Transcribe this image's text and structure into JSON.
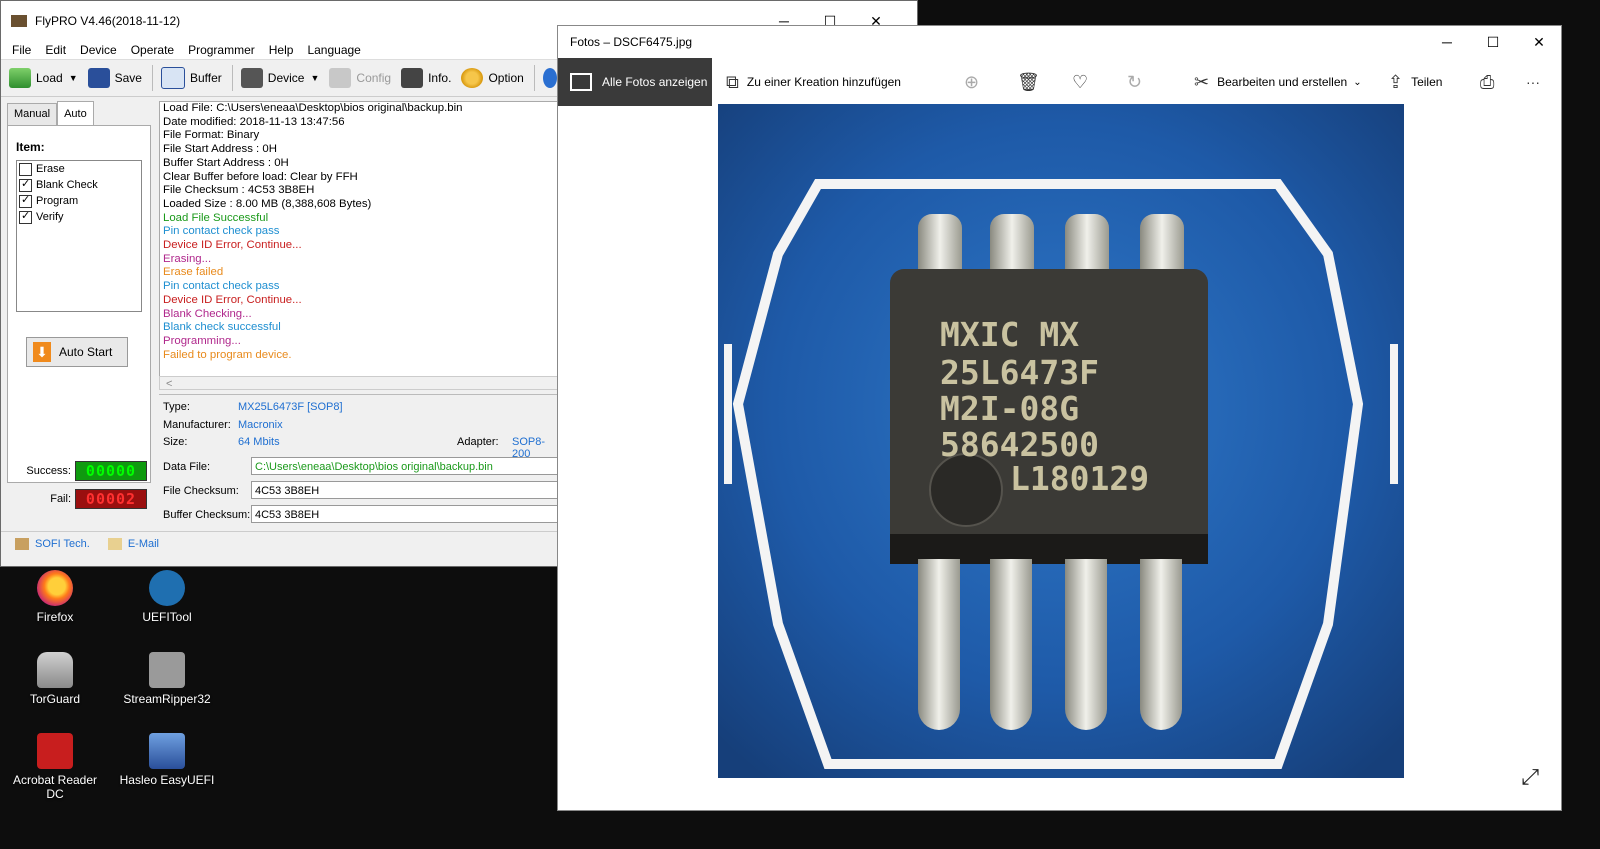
{
  "flypro": {
    "title": "FlyPRO V4.46(2018-11-12)",
    "menu": [
      "File",
      "Edit",
      "Device",
      "Operate",
      "Programmer",
      "Help",
      "Language"
    ],
    "toolbar": {
      "load": "Load",
      "save": "Save",
      "buffer": "Buffer",
      "device": "Device",
      "config": "Config",
      "info": "Info.",
      "option": "Option"
    },
    "tabs": {
      "manual": "Manual",
      "auto": "Auto"
    },
    "item_title": "Item:",
    "items": [
      {
        "label": "Erase",
        "checked": false
      },
      {
        "label": "Blank Check",
        "checked": true
      },
      {
        "label": "Program",
        "checked": true
      },
      {
        "label": "Verify",
        "checked": true
      }
    ],
    "auto_start": "Auto Start",
    "success_label": "Success:",
    "success_value": "00000",
    "fail_label": "Fail:",
    "fail_value": "00002",
    "log": [
      {
        "text": "Load File: C:\\Users\\eneaa\\Desktop\\bios original\\backup.bin",
        "color": "#000000"
      },
      {
        "text": "Date modified: 2018-11-13 13:47:56",
        "color": "#000000"
      },
      {
        "text": "File Format: Binary",
        "color": "#000000"
      },
      {
        "text": "File Start Address      : 0H",
        "color": "#000000"
      },
      {
        "text": "Buffer Start Address  : 0H",
        "color": "#000000"
      },
      {
        "text": "Clear Buffer before load: Clear by FFH",
        "color": "#000000"
      },
      {
        "text": "File Checksum  : 4C53 3B8EH",
        "color": "#000000"
      },
      {
        "text": "Loaded Size  : 8.00 MB (8,388,608 Bytes)",
        "color": "#000000"
      },
      {
        "text": "Load File Successful",
        "color": "#1b9a1b"
      },
      {
        "text": "Pin contact check pass",
        "color": "#1f8fd1"
      },
      {
        "text": "Device ID Error, Continue...",
        "color": "#c81e1e"
      },
      {
        "text": "Erasing...",
        "color": "#b0288c"
      },
      {
        "text": "Erase failed",
        "color": "#e88a1c"
      },
      {
        "text": "Pin contact check pass",
        "color": "#1f8fd1"
      },
      {
        "text": "Device ID Error, Continue...",
        "color": "#c81e1e"
      },
      {
        "text": "Blank Checking...",
        "color": "#b0288c"
      },
      {
        "text": "Blank check successful",
        "color": "#1f8fd1"
      },
      {
        "text": "Programming...",
        "color": "#b0288c"
      },
      {
        "text": "Failed to program device.",
        "color": "#e88a1c"
      }
    ],
    "type_label": "Type:",
    "type_value": "MX25L6473F [SOP8]",
    "manufacturer_label": "Manufacturer:",
    "manufacturer_value": "Macronix",
    "size_label": "Size:",
    "size_value": "64 Mbits",
    "adapter_label": "Adapter:",
    "adapter_value": "SOP8-200",
    "data_file_label": "Data File:",
    "data_file_value": "C:\\Users\\eneaa\\Desktop\\bios original\\backup.bin",
    "file_checksum_label": "File Checksum:",
    "file_checksum_value": "4C53 3B8EH",
    "buffer_checksum_label": "Buffer Checksum:",
    "buffer_checksum_value": "4C53 3B8EH",
    "status_sofi": "SOFI Tech.",
    "status_email": "E-Mail"
  },
  "photos": {
    "title": "Fotos – DSCF6475.jpg",
    "all_photos": "Alle Fotos anzeigen",
    "add_creation": "Zu einer Kreation hinzufügen",
    "edit_create": "Bearbeiten und erstellen",
    "share": "Teilen",
    "more": "···",
    "chip_text": [
      "MXIC MX",
      "25L6473F",
      "M2I-08G",
      "58642500",
      "L180129"
    ]
  },
  "desktop": {
    "icons": [
      {
        "label": "Firefox"
      },
      {
        "label": "UEFITool"
      },
      {
        "label": "TorGuard"
      },
      {
        "label": "StreamRipper32"
      },
      {
        "label": "Acrobat Reader DC"
      },
      {
        "label": "Hasleo EasyUEFI"
      }
    ]
  },
  "colors": {
    "accent_blue": "#1f6fd1",
    "photo_bg": "#1e5aa8",
    "chip": "#3b3a36"
  }
}
